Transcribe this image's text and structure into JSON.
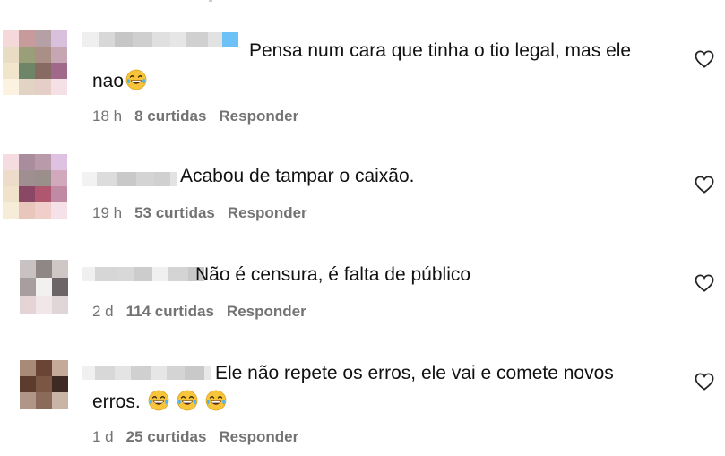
{
  "comments": [
    {
      "text_line1": "Pensa num cara que tinha o tio legal, mas ele",
      "text_line2": "nao",
      "emoji_count": 1,
      "time": "18 h",
      "likes": "8 curtidas",
      "reply": "Responder"
    },
    {
      "text_line1": "Acabou de tampar o caixão.",
      "text_line2": "",
      "emoji_count": 0,
      "time": "19 h",
      "likes": "53 curtidas",
      "reply": "Responder"
    },
    {
      "text_line1": "Não é censura, é falta de público",
      "text_line2": "",
      "emoji_count": 0,
      "time": "2 d",
      "likes": "114 curtidas",
      "reply": "Responder"
    },
    {
      "text_line1": "Ele não repete os erros, ele vai e comete novos",
      "text_line2": "erros.",
      "emoji_count": 3,
      "time": "1 d",
      "likes": "25 curtidas",
      "reply": "Responder"
    }
  ],
  "icons": {
    "like": "heart-outline-icon",
    "emoji": "face-with-tears-of-joy"
  },
  "colors": {
    "meta_text": "#737373",
    "emoji_yellow": "#f8c53a"
  }
}
